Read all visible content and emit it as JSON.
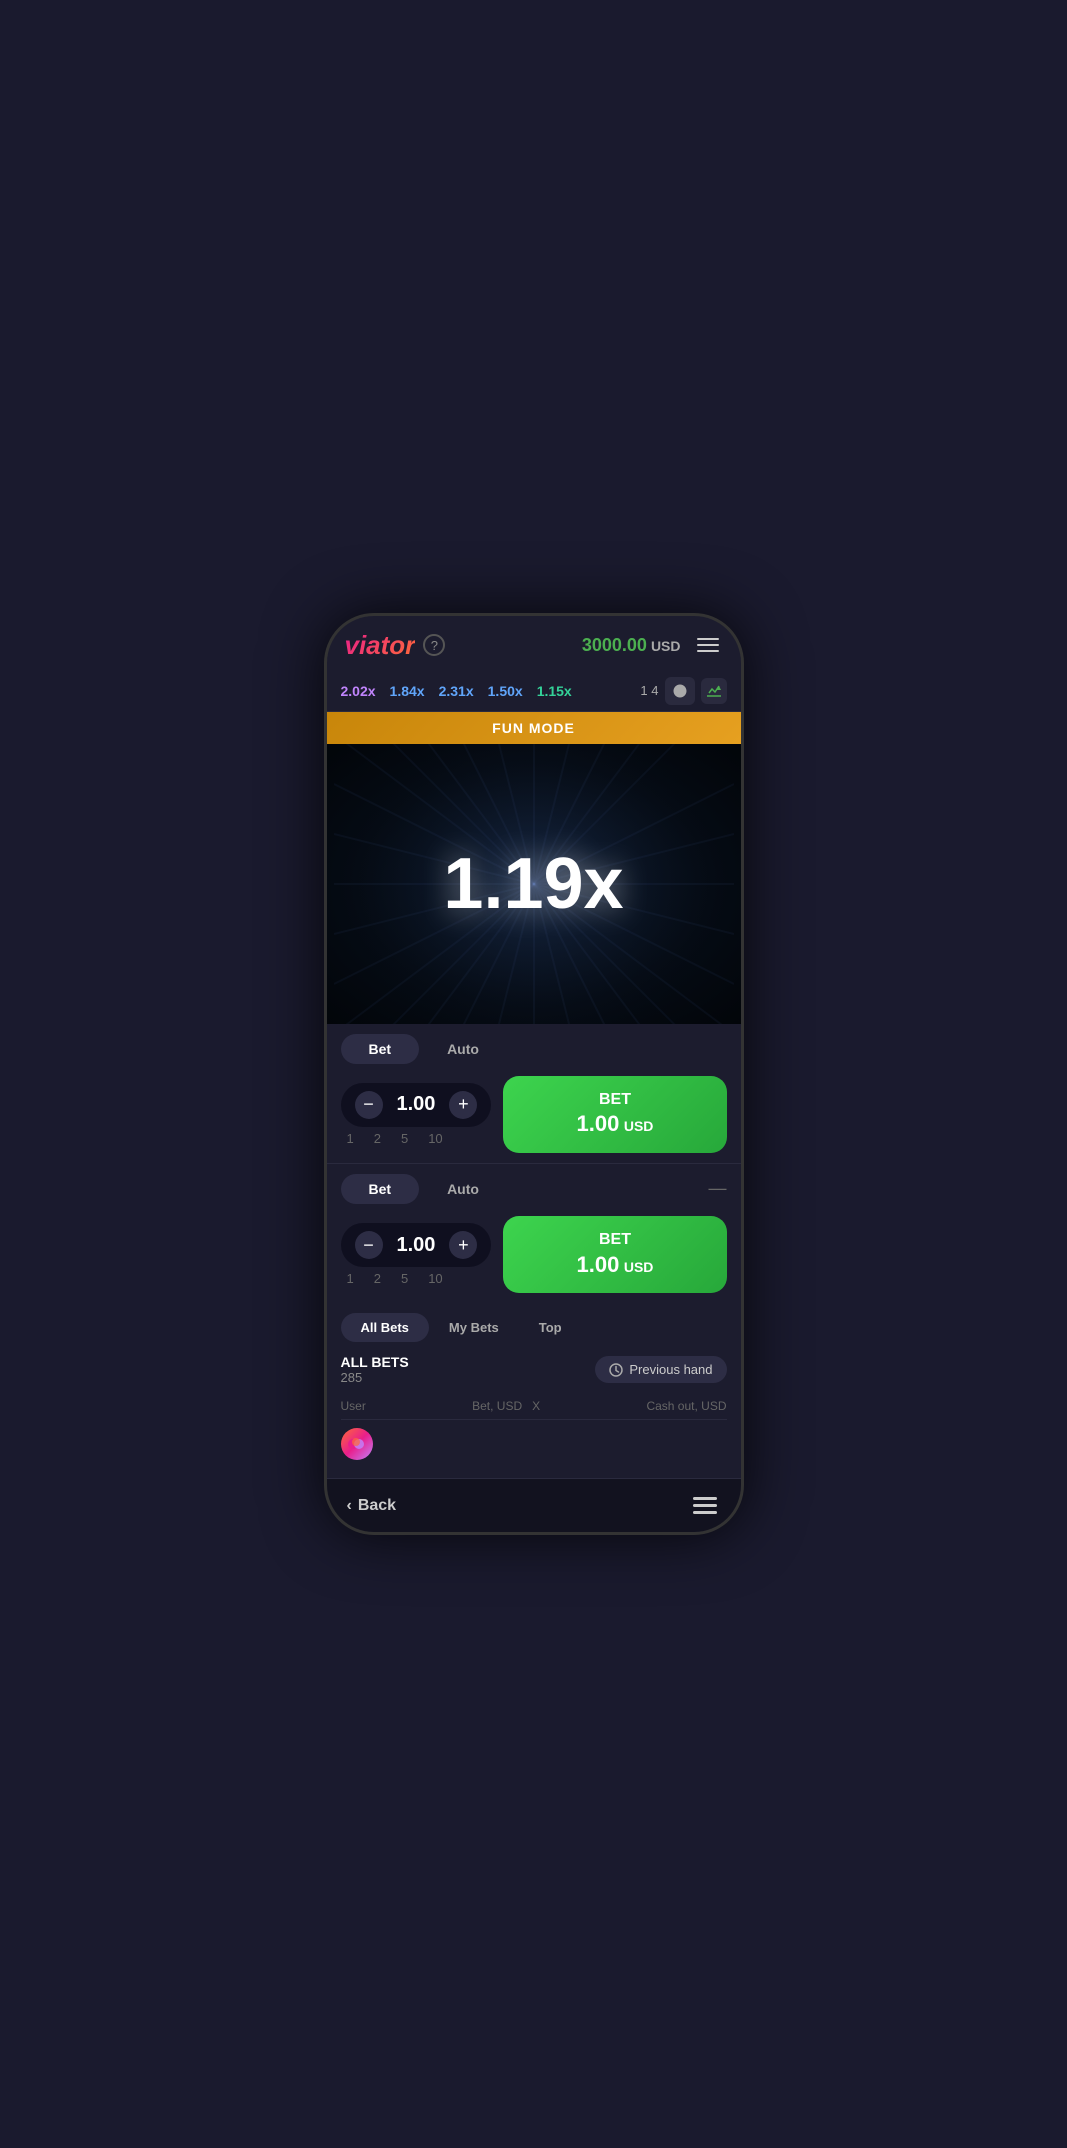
{
  "app": {
    "logo": "viator",
    "help_label": "?",
    "balance": "3000.00",
    "currency": "USD"
  },
  "multiplier_bar": {
    "items": [
      {
        "value": "2.02x",
        "color": "purple"
      },
      {
        "value": "1.84x",
        "color": "blue"
      },
      {
        "value": "2.31x",
        "color": "blue"
      },
      {
        "value": "1.50x",
        "color": "blue"
      },
      {
        "value": "1.15x",
        "color": "cyan"
      }
    ],
    "count": "1 4"
  },
  "fun_mode": {
    "label": "FUN MODE"
  },
  "game": {
    "multiplier": "1.19x"
  },
  "bet_panel_1": {
    "tabs": [
      "Bet",
      "Auto"
    ],
    "active_tab": "Bet",
    "bet_value": "1.00",
    "quick_values": [
      "1",
      "2",
      "5",
      "10"
    ],
    "button_label": "BET",
    "button_amount": "1.00",
    "button_currency": "USD"
  },
  "bet_panel_2": {
    "tabs": [
      "Bet",
      "Auto"
    ],
    "active_tab": "Bet",
    "bet_value": "1.00",
    "quick_values": [
      "1",
      "2",
      "5",
      "10"
    ],
    "button_label": "BET",
    "button_amount": "1.00",
    "button_currency": "USD",
    "minimize_icon": "—"
  },
  "bets_section": {
    "tabs": [
      "All Bets",
      "My Bets",
      "Top"
    ],
    "active_tab": "All Bets",
    "title": "ALL BETS",
    "count": "285",
    "previous_hand_label": "Previous hand",
    "columns": {
      "user": "User",
      "bet": "Bet, USD",
      "x": "X",
      "cashout": "Cash out, USD"
    }
  },
  "bottom_nav": {
    "back_label": "Back",
    "back_icon": "‹"
  }
}
